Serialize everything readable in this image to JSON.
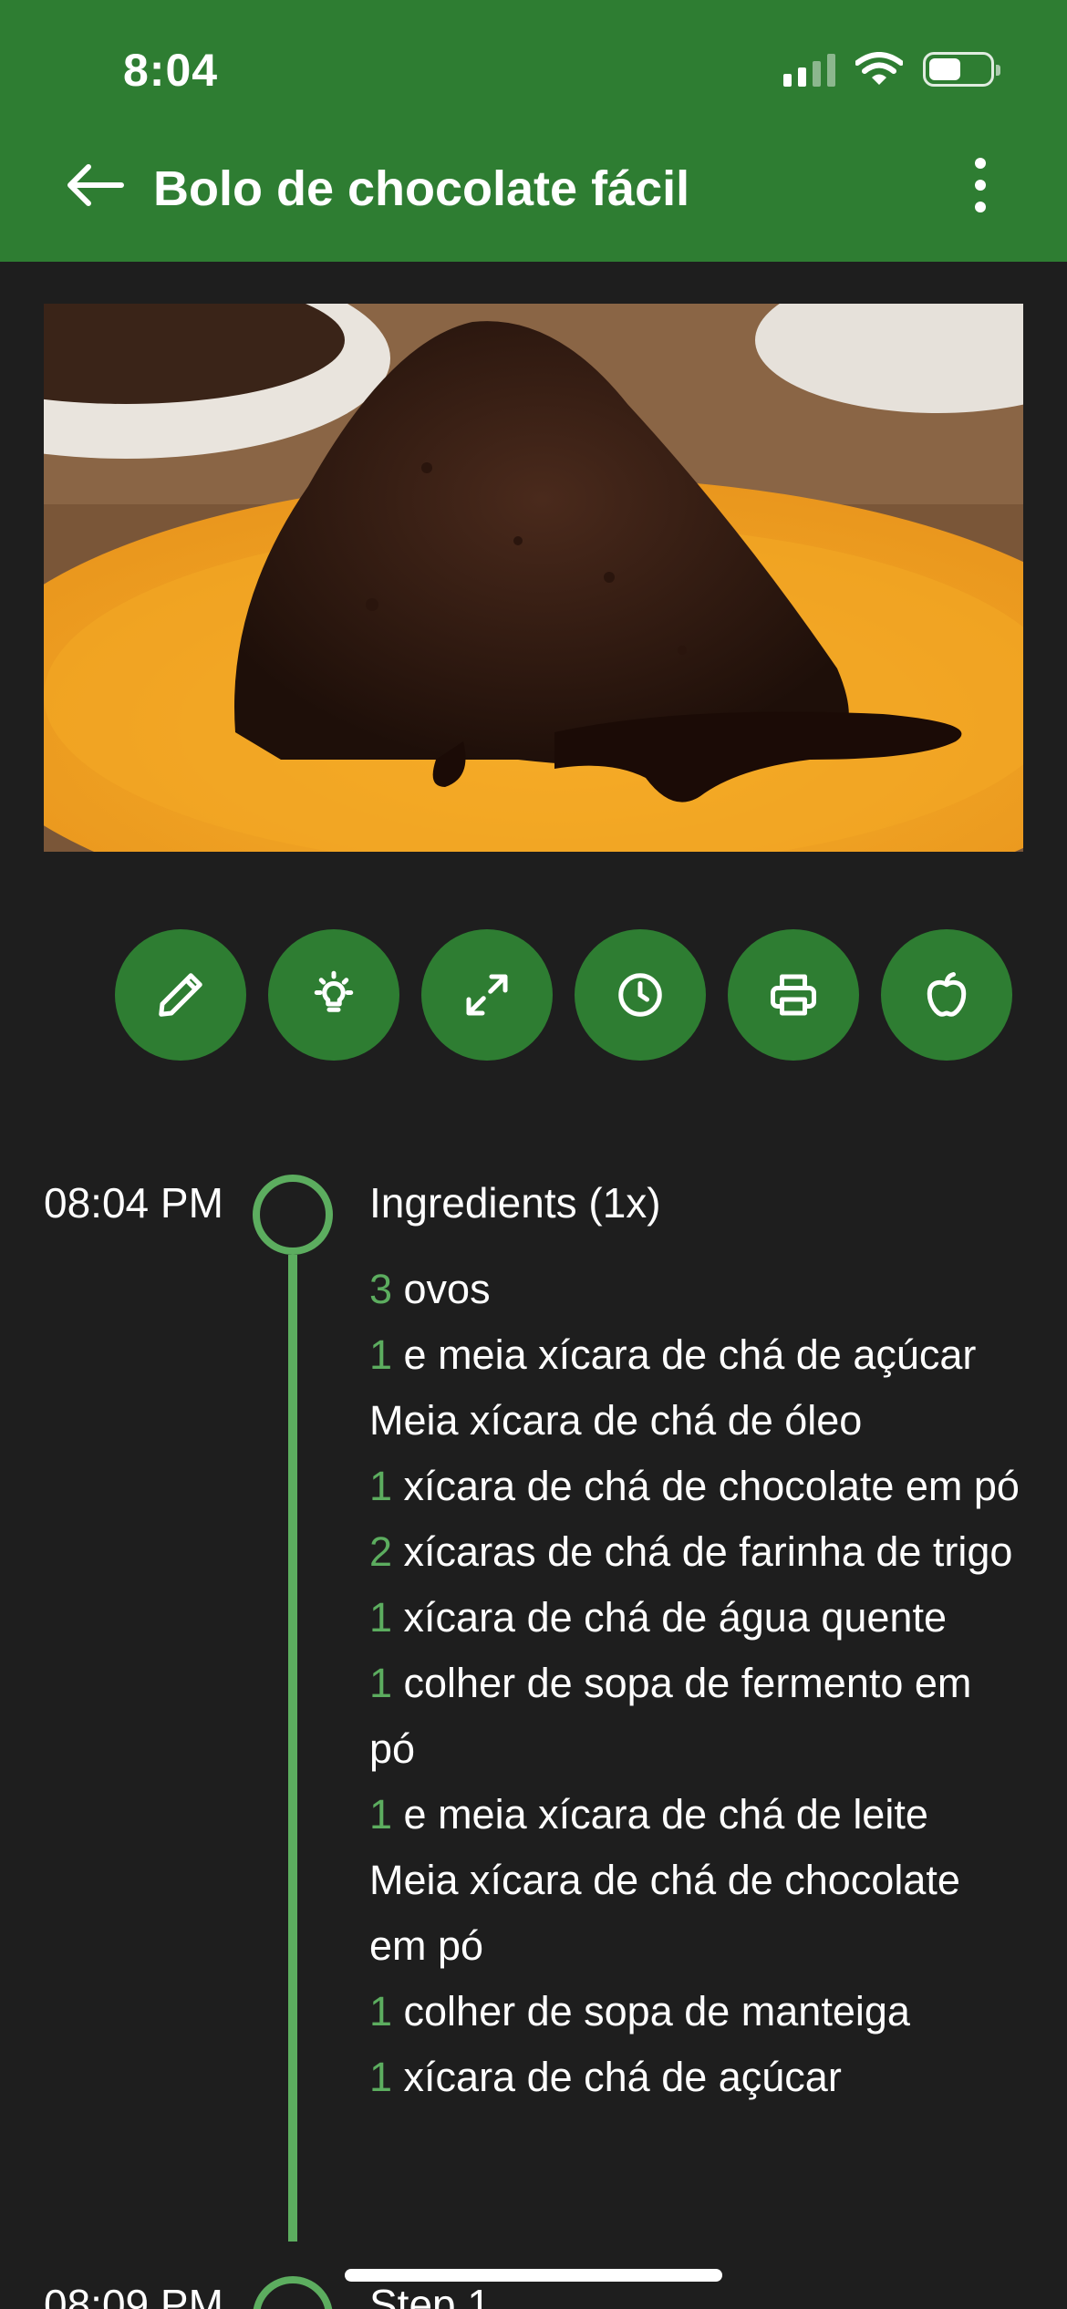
{
  "status_bar": {
    "time": "8:04",
    "signal_icon": "cellular-signal-icon",
    "wifi_icon": "wifi-icon",
    "battery_icon": "battery-icon",
    "battery_level": 0.55
  },
  "header": {
    "back_icon": "arrow-left-icon",
    "title": "Bolo de chocolate fácil",
    "menu_icon": "more-vertical-icon",
    "background": "#2e7d32"
  },
  "hero": {
    "image": "chocolate-cake-photo"
  },
  "actions": [
    {
      "name": "edit",
      "icon": "pencil-icon"
    },
    {
      "name": "tips",
      "icon": "lightbulb-icon"
    },
    {
      "name": "fullscreen",
      "icon": "expand-icon"
    },
    {
      "name": "timer",
      "icon": "clock-icon"
    },
    {
      "name": "print",
      "icon": "printer-icon"
    },
    {
      "name": "nutrition",
      "icon": "apple-icon"
    }
  ],
  "timeline": [
    {
      "time": "08:04 PM",
      "title": "Ingredients (1x)",
      "items": [
        {
          "qty": "3",
          "text": " ovos"
        },
        {
          "qty": "1",
          "text": " e meia xícara de chá de açúcar"
        },
        {
          "qty": "",
          "text": "Meia xícara de chá de óleo"
        },
        {
          "qty": "1",
          "text": " xícara de chá de chocolate em pó"
        },
        {
          "qty": "2",
          "text": " xícaras de chá de farinha de trigo"
        },
        {
          "qty": "1",
          "text": " xícara de chá de água quente"
        },
        {
          "qty": "1",
          "text": " colher de sopa de fermento em pó"
        },
        {
          "qty": "1",
          "text": " e meia xícara de chá de leite"
        },
        {
          "qty": "",
          "text": "Meia xícara de chá de chocolate em pó"
        },
        {
          "qty": "1",
          "text": " colher de sopa de manteiga"
        },
        {
          "qty": "1",
          "text": " xícara de chá de açúcar"
        }
      ]
    },
    {
      "time": "08:09 PM",
      "title": "Step 1"
    }
  ],
  "colors": {
    "accent": "#5cad5f",
    "button": "#2e7d32",
    "background": "#1e1e1e"
  }
}
